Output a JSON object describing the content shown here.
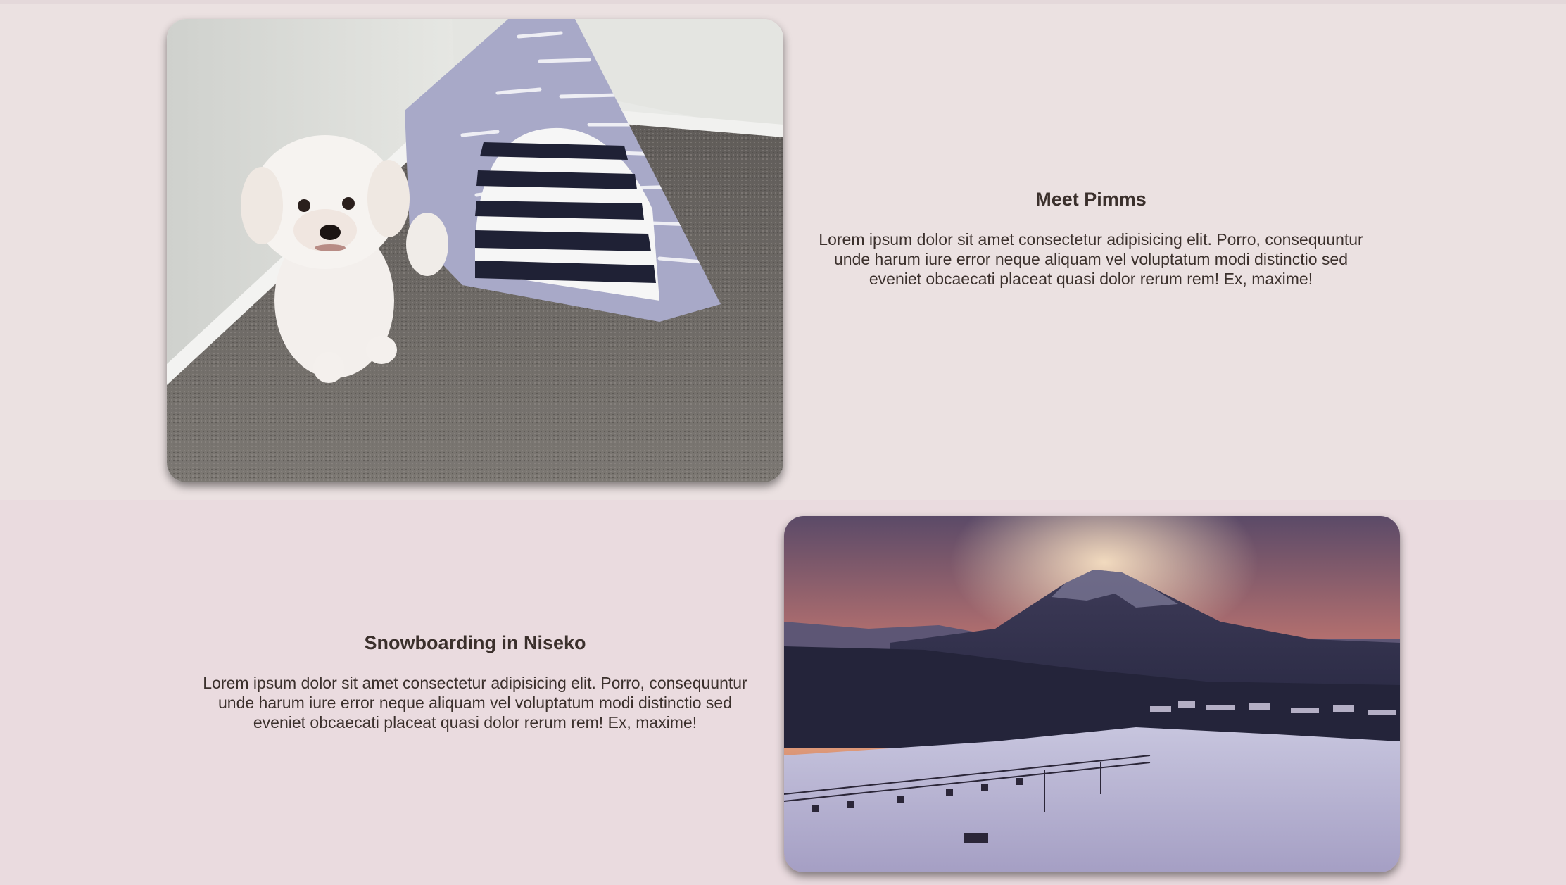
{
  "sections": [
    {
      "title": "Meet Pimms",
      "body": "Lorem ipsum dolor sit amet consectetur adipisicing elit. Porro, consequuntur unde harum iure error neque aliquam vel voluptatum modi distinctio sed eveniet obcaecati placeat quasi dolor rerum rem! Ex, maxime!",
      "image": "dog-photo"
    },
    {
      "title": "Snowboarding in Niseko",
      "body": "Lorem ipsum dolor sit amet consectetur adipisicing elit. Porro, consequuntur unde harum iure error neque aliquam vel voluptatum modi distinctio sed eveniet obcaecati placeat quasi dolor rerum rem! Ex, maxime!",
      "image": "mountain-photo"
    }
  ],
  "colors": {
    "section_1_bg": "#ebe1e1",
    "section_2_bg": "#eadbdf",
    "text": "#3b302c"
  }
}
